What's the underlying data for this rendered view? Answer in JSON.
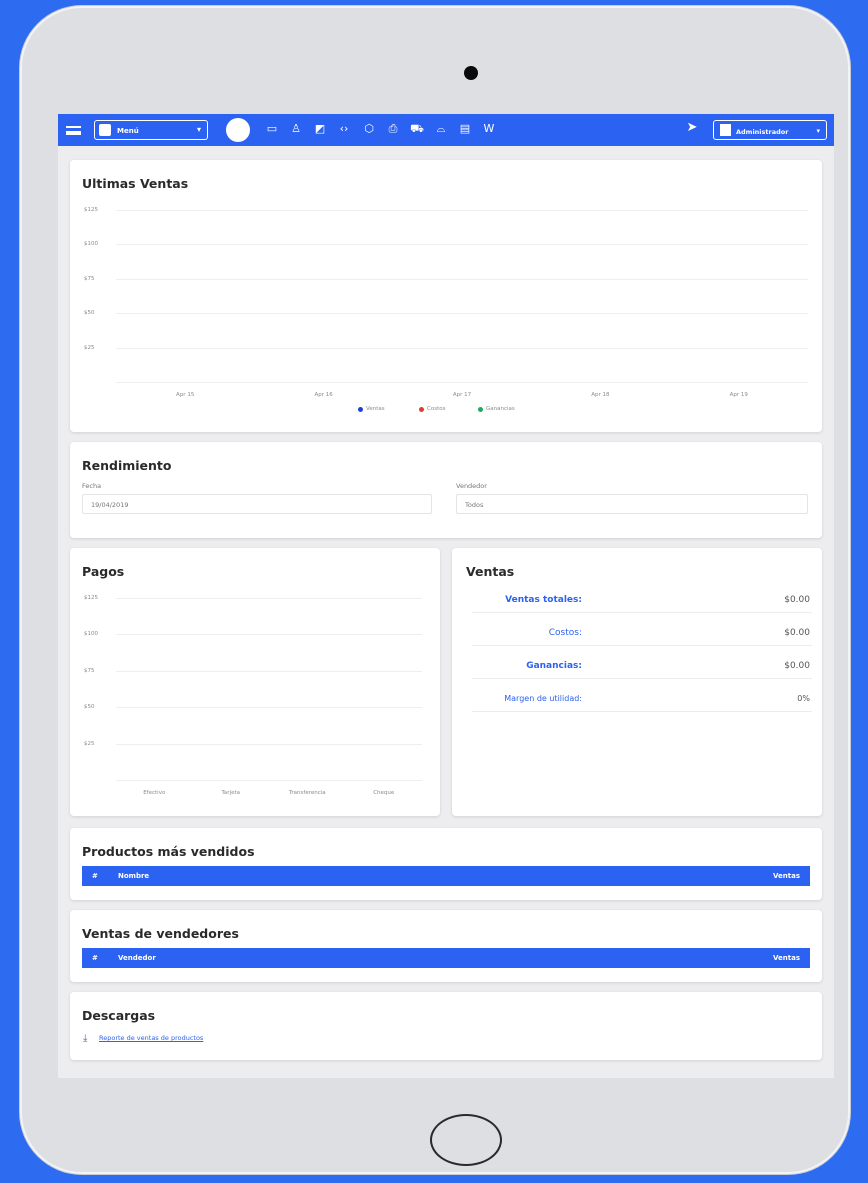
{
  "topbar": {
    "menu_label": "Menú",
    "menu_caret": "▾",
    "nav_icons": [
      "chart-icon",
      "id-card-icon",
      "user-icon",
      "tags-icon",
      "code-icon",
      "cube-icon",
      "printer-icon",
      "truck-icon",
      "basket-icon",
      "clipboard-icon",
      "wordpress-icon"
    ],
    "user_label": "Administrador",
    "user_caret": "▾"
  },
  "ultimas_ventas": {
    "title": "Ultimas Ventas",
    "y_ticks": [
      "$125",
      "$100",
      "$75",
      "$50",
      "$25"
    ],
    "x_ticks": [
      "Apr 15",
      "Apr 16",
      "Apr 17",
      "Apr 18",
      "Apr 19"
    ],
    "legend": [
      {
        "label": "Ventas",
        "color": "#1f3fd6"
      },
      {
        "label": "Costos",
        "color": "#e53935"
      },
      {
        "label": "Ganancias",
        "color": "#1faa59"
      }
    ]
  },
  "rendimiento": {
    "title": "Rendimiento",
    "fecha_label": "Fecha",
    "fecha_value": "19/04/2019",
    "vendedor_label": "Vendedor",
    "vendedor_value": "Todos"
  },
  "pagos": {
    "title": "Pagos",
    "y_ticks": [
      "$125",
      "$100",
      "$75",
      "$50",
      "$25"
    ],
    "x_ticks": [
      "Efectivo",
      "Tarjeta",
      "Transferencia",
      "Cheque"
    ]
  },
  "ventas": {
    "title": "Ventas",
    "rows": [
      {
        "label": "Ventas totales:",
        "value": "$0.00"
      },
      {
        "label": "Costos:",
        "value": "$0.00"
      },
      {
        "label": "Ganancias:",
        "value": "$0.00"
      },
      {
        "label": "Margen de utilidad:",
        "value": "0%"
      }
    ]
  },
  "productos": {
    "title": "Productos más vendidos",
    "col_num": "#",
    "col_name": "Nombre",
    "col_sales": "Ventas"
  },
  "vendedores": {
    "title": "Ventas de vendedores",
    "col_num": "#",
    "col_name": "Vendedor",
    "col_sales": "Ventas"
  },
  "descargas": {
    "title": "Descargas",
    "link": "Reporte de ventas de productos"
  },
  "chart_data": [
    {
      "type": "line",
      "title": "Ultimas Ventas",
      "categories": [
        "Apr 15",
        "Apr 16",
        "Apr 17",
        "Apr 18",
        "Apr 19"
      ],
      "series": [
        {
          "name": "Ventas",
          "values": []
        },
        {
          "name": "Costos",
          "values": []
        },
        {
          "name": "Ganancias",
          "values": []
        }
      ],
      "ylim": [
        0,
        125
      ],
      "legend": "bottom",
      "grid": true
    },
    {
      "type": "bar",
      "title": "Pagos",
      "categories": [
        "Efectivo",
        "Tarjeta",
        "Transferencia",
        "Cheque"
      ],
      "values": [],
      "ylim": [
        0,
        125
      ],
      "grid": true
    }
  ]
}
